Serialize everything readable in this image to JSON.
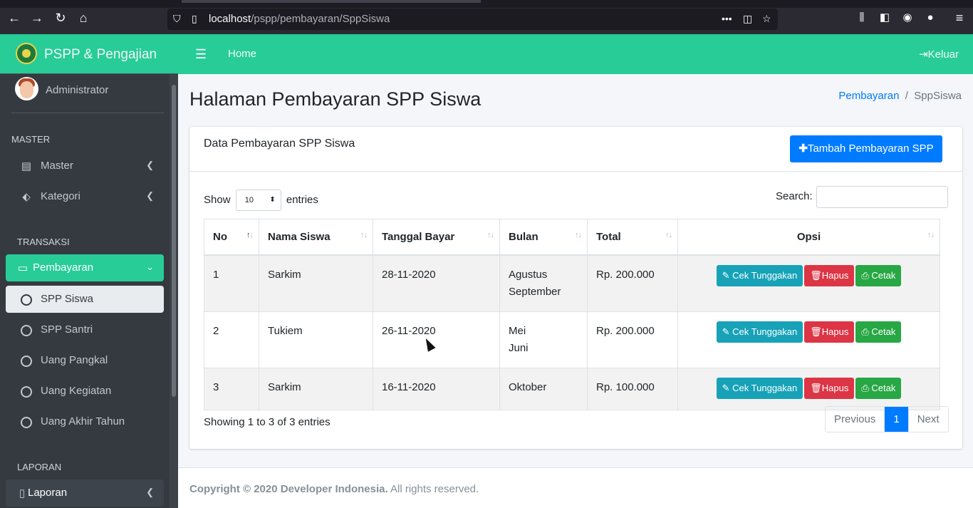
{
  "browser": {
    "url_host": "localhost",
    "url_path": "/pspp/pembayaran/SppSiswa"
  },
  "brand": {
    "name": "PSPP & Pengajian"
  },
  "user": {
    "name": "Administrator"
  },
  "sidebar": {
    "sections": [
      "MASTER",
      "TRANSAKSI",
      "LAPORAN"
    ],
    "items": [
      {
        "label": "Master"
      },
      {
        "label": "Kategori"
      },
      {
        "label": "Pembayaran"
      },
      {
        "label": "SPP Siswa"
      },
      {
        "label": "SPP Santri"
      },
      {
        "label": "Uang Pangkal"
      },
      {
        "label": "Uang Kegiatan"
      },
      {
        "label": "Uang Akhir Tahun"
      },
      {
        "label": "Laporan"
      }
    ]
  },
  "topnav": {
    "home": "Home",
    "logout": "Keluar"
  },
  "page": {
    "title": "Halaman Pembayaran SPP Siswa",
    "breadcrumb": {
      "parent": "Pembayaran",
      "current": "SppSiswa"
    }
  },
  "card": {
    "title": "Data Pembayaran SPP Siswa",
    "add_button": "Tambah Pembayaran SPP"
  },
  "table_controls": {
    "show_label": "Show",
    "entries_value": "10",
    "entries_label": "entries",
    "search_label": "Search:"
  },
  "table": {
    "headers": [
      "No",
      "Nama Siswa",
      "Tanggal Bayar",
      "Bulan",
      "Total",
      "Opsi"
    ],
    "rows": [
      {
        "no": "1",
        "nama": "Sarkim",
        "tanggal": "28-11-2020",
        "bulan1": "Agustus",
        "bulan2": "September",
        "total": "Rp. 200.000"
      },
      {
        "no": "2",
        "nama": "Tukiem",
        "tanggal": "26-11-2020",
        "bulan1": "Mei",
        "bulan2": "Juni",
        "total": "Rp. 200.000"
      },
      {
        "no": "3",
        "nama": "Sarkim",
        "tanggal": "16-11-2020",
        "bulan1": "Oktober",
        "bulan2": "",
        "total": "Rp. 100.000"
      }
    ],
    "actions": {
      "check": "Cek Tunggakan",
      "delete": "Hapus",
      "print": "Cetak"
    }
  },
  "pagination": {
    "info": "Showing 1 to 3 of 3 entries",
    "previous": "Previous",
    "page": "1",
    "next": "Next"
  },
  "footer": {
    "copyright": "Copyright © 2020 Developer Indonesia.",
    "rights": "All rights reserved."
  },
  "colors": {
    "accent": "#28cc96",
    "primary": "#007bff",
    "sidebar": "#343a40"
  }
}
